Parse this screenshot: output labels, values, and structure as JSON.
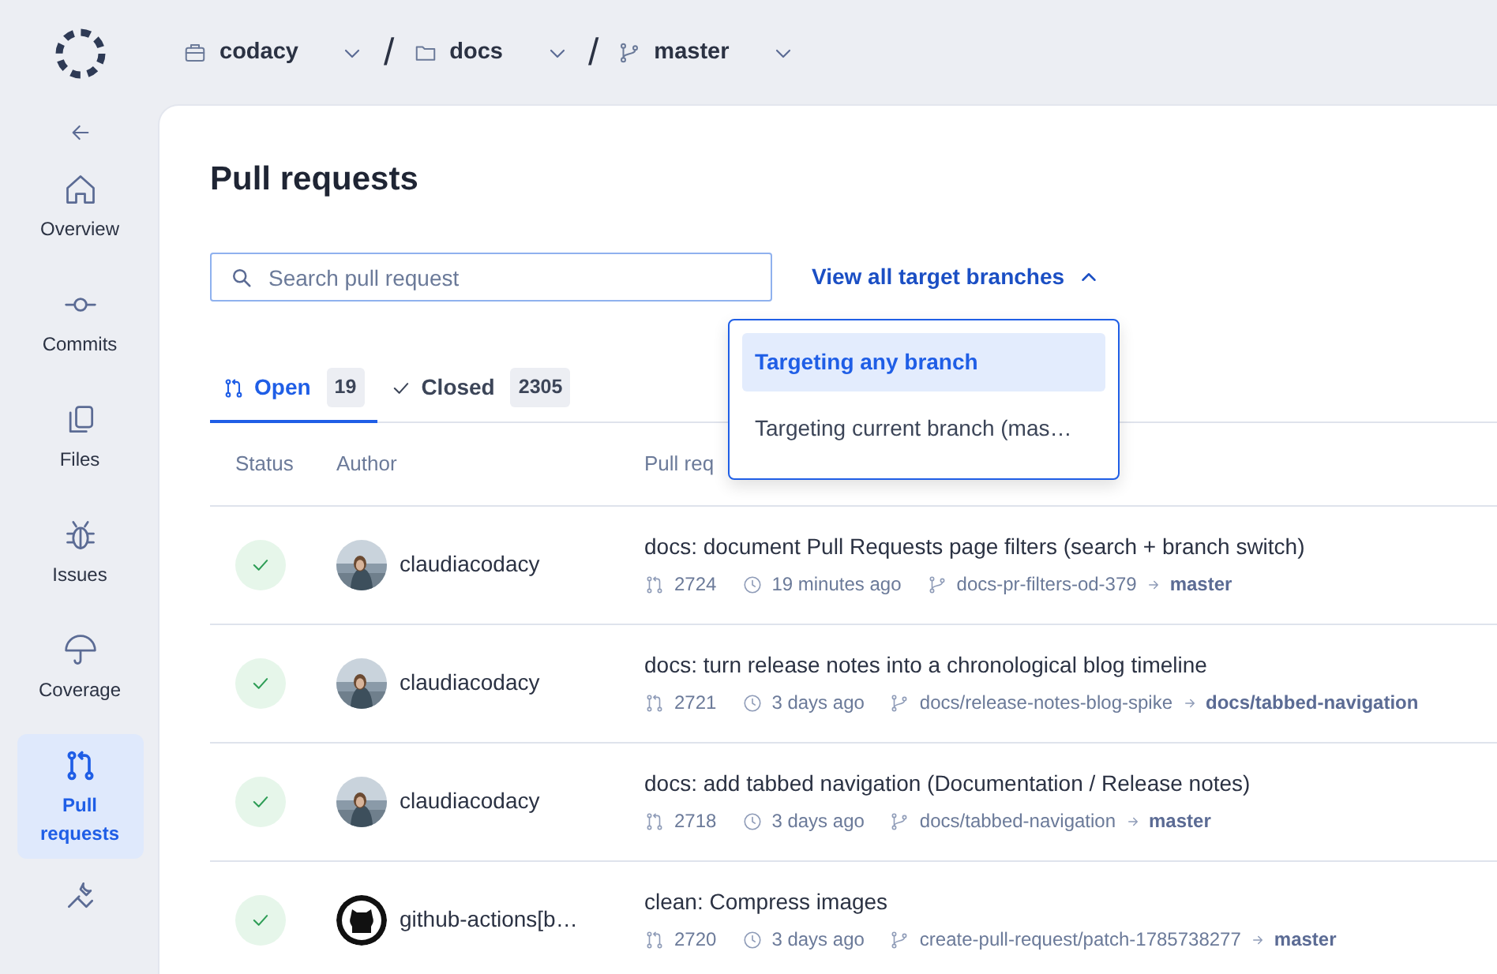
{
  "breadcrumb": [
    {
      "kind": "org",
      "label": "codacy"
    },
    {
      "kind": "separator",
      "label": "/"
    },
    {
      "kind": "repo",
      "label": "docs"
    },
    {
      "kind": "separator",
      "label": "/"
    },
    {
      "kind": "branch",
      "label": "master"
    }
  ],
  "sidebar": {
    "items": [
      {
        "kind": "back"
      },
      {
        "kind": "home",
        "label": "Overview",
        "selected": false
      },
      {
        "kind": "commit",
        "label": "Commits",
        "selected": false
      },
      {
        "kind": "files",
        "label": "Files",
        "selected": false
      },
      {
        "kind": "bug",
        "label": "Issues",
        "selected": false
      },
      {
        "kind": "umbrella",
        "label": "Coverage",
        "selected": false
      },
      {
        "kind": "pull",
        "label": "Pull requests",
        "selected": true
      },
      {
        "kind": "tools"
      }
    ]
  },
  "page": {
    "title": "Pull requests"
  },
  "search": {
    "placeholder": "Search pull request"
  },
  "branch_filter": {
    "label": "View all target branches",
    "expanded": true,
    "options": [
      {
        "label": "Targeting any branch",
        "selected": true
      },
      {
        "label": "Targeting current branch (mas…",
        "selected": false
      }
    ]
  },
  "tabs": [
    {
      "kind": "open",
      "label": "Open",
      "count": "19",
      "selected": true
    },
    {
      "kind": "closed",
      "label": "Closed",
      "count": "2305",
      "selected": false
    }
  ],
  "table": {
    "columns": [
      "Status",
      "Author",
      "Pull req"
    ],
    "rows": [
      {
        "status": {
          "kind": "passed"
        },
        "author": {
          "name": "claudiacodacy"
        },
        "title": "docs: document Pull Requests page filters (search + branch switch)",
        "number": "2724",
        "time": "19 minutes ago",
        "source": "docs-pr-filters-od-379",
        "target": "master"
      },
      {
        "status": {
          "kind": "passed"
        },
        "author": {
          "name": "claudiacodacy"
        },
        "title": "docs: turn release notes into a chronological blog timeline",
        "number": "2721",
        "time": "3 days ago",
        "source": "docs/release-notes-blog-spike",
        "target": "docs/tabbed-navigation"
      },
      {
        "status": {
          "kind": "passed"
        },
        "author": {
          "name": "claudiacodacy"
        },
        "title": "docs: add tabbed navigation (Documentation / Release notes)",
        "number": "2718",
        "time": "3 days ago",
        "source": "docs/tabbed-navigation",
        "target": "master"
      },
      {
        "status": {
          "kind": "passed"
        },
        "author": {
          "kind": "github",
          "name": "github-actions[b…"
        },
        "title": "clean: Compress images",
        "number": "2720",
        "time": "3 days ago",
        "source": "create-pull-request/patch-1785738277",
        "target": "master"
      }
    ]
  }
}
